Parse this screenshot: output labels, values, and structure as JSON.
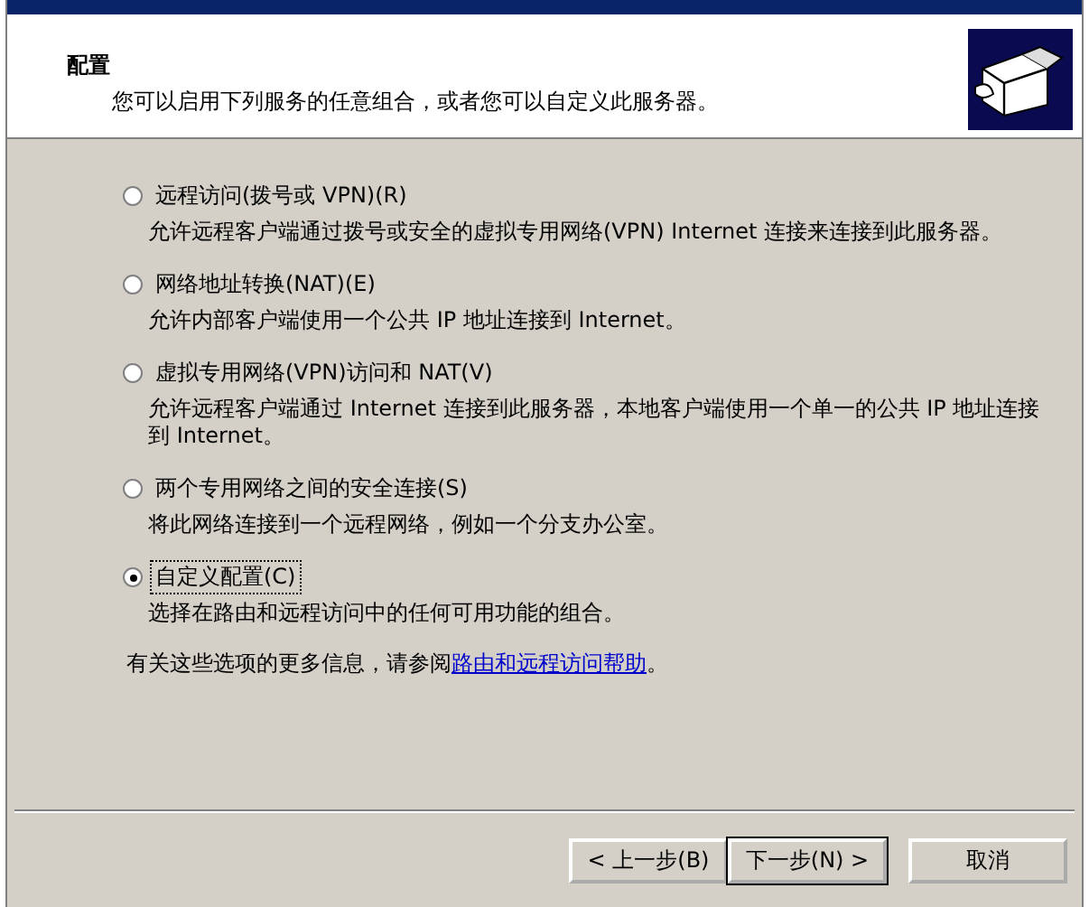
{
  "header": {
    "title": "配置",
    "subtitle": "您可以启用下列服务的任意组合，或者您可以自定义此服务器。"
  },
  "options": [
    {
      "label": "远程访问(拨号或 VPN)(R)",
      "description": "允许远程客户端通过拨号或安全的虚拟专用网络(VPN) Internet 连接来连接到此服务器。",
      "selected": false
    },
    {
      "label": "网络地址转换(NAT)(E)",
      "description": "允许内部客户端使用一个公共 IP 地址连接到 Internet。",
      "selected": false
    },
    {
      "label": "虚拟专用网络(VPN)访问和 NAT(V)",
      "description": "允许远程客户端通过 Internet 连接到此服务器，本地客户端使用一个单一的公共 IP 地址连接到 Internet。",
      "selected": false
    },
    {
      "label": "两个专用网络之间的安全连接(S)",
      "description": "将此网络连接到一个远程网络，例如一个分支办公室。",
      "selected": false
    },
    {
      "label": "自定义配置(C)",
      "description": "选择在路由和远程访问中的任何可用功能的组合。",
      "selected": true
    }
  ],
  "help": {
    "text": "有关这些选项的更多信息，请参阅",
    "link": "路由和远程访问帮助",
    "end": "。"
  },
  "buttons": [
    {
      "label": "< 上一步(B)",
      "default": false
    },
    {
      "label": "下一步(N) >",
      "default": true
    },
    {
      "label": "取消",
      "default": false
    }
  ]
}
